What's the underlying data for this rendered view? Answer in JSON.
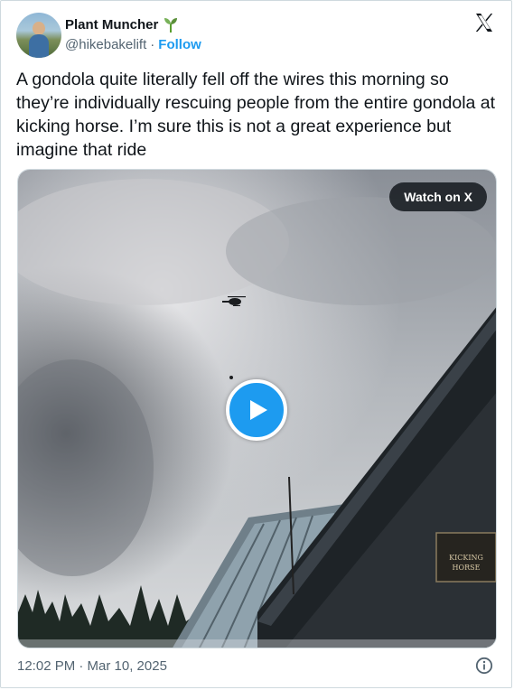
{
  "author": {
    "display_name": "Plant Muncher",
    "emoji_icon": "sprout-icon",
    "handle": "@hikebakelift",
    "separator": "·",
    "follow_label": "Follow"
  },
  "platform_icon": "x-logo-icon",
  "tweet": {
    "text": "A gondola quite literally fell off the wires this morning so they’re individually rescuing people from the entire gondola at kicking horse. I’m sure this is not a great experience but imagine that ride"
  },
  "media": {
    "watch_label": "Watch on X",
    "sign_text_line1": "KICKING",
    "sign_text_line2": "HORSE"
  },
  "footer": {
    "timestamp": "12:02 PM · Mar 10, 2025",
    "info_icon": "info-icon"
  },
  "colors": {
    "accent": "#1d9bf0",
    "text": "#0f1419",
    "muted": "#536471"
  }
}
